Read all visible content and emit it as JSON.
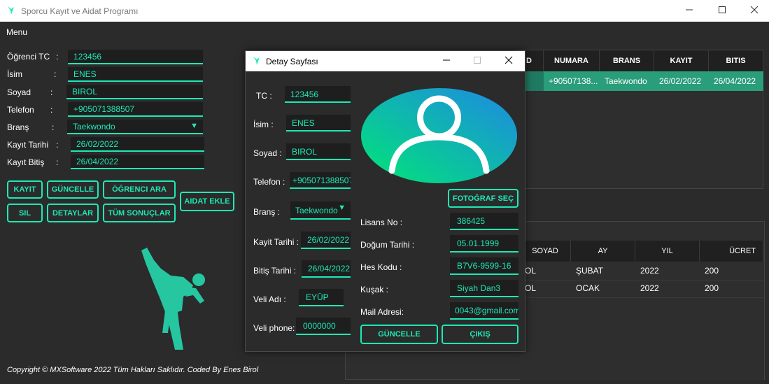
{
  "window": {
    "title": "Sporcu Kayıt ve Aidat Programı"
  },
  "menu": {
    "label": "Menu"
  },
  "form": {
    "tc_label": "Öğrenci TC",
    "tc_sep": ":",
    "tc_value": "123456",
    "isim_label": "İsim",
    "isim_sep": ":",
    "isim_value": "ENES",
    "soyad_label": "Soyad",
    "soyad_sep": ":",
    "soyad_value": "BIROL",
    "telefon_label": "Telefon",
    "telefon_sep": ":",
    "telefon_value": "+905071388507",
    "brans_label": "Branş",
    "brans_sep": ":",
    "brans_value": "Taekwondo",
    "kayit_label": "Kayıt Tarihi",
    "kayit_sep": ":",
    "kayit_value": "26/02/2022",
    "bitis_label": "Kayıt Bitiş",
    "bitis_sep": ":",
    "bitis_value": "26/04/2022"
  },
  "buttons": {
    "kayit": "KAYIT",
    "guncelle": "GÜNCELLE",
    "ogrenci_ara": "ÖĞRENCI ARA",
    "aidat_ekle": "AIDAT EKLE",
    "sil": "SIL",
    "detaylar": "DETAYLAR",
    "tum_sonuclar": "TÜM SONUÇLAR"
  },
  "footer": {
    "text": "Copyright © MXSoftware 2022 Tüm Hakları Saklıdır. Coded By Enes Birol"
  },
  "students_grid": {
    "headers": [
      "D",
      "NUMARA",
      "BRANS",
      "KAYIT",
      "BITIS"
    ],
    "row": [
      "",
      "+90507138...",
      "Taekwondo",
      "26/02/2022",
      "26/04/2022"
    ]
  },
  "payments_grid": {
    "headers": [
      "SOYAD",
      "AY",
      "YIL",
      "ÜCRET"
    ],
    "rows": [
      [
        "OL",
        "ŞUBAT",
        "2022",
        "200"
      ],
      [
        "OL",
        "OCAK",
        "2022",
        "200"
      ]
    ]
  },
  "dialog": {
    "title": "Detay Sayfası",
    "tc_label": "TC :",
    "tc_value": "123456",
    "isim_label": "İsim :",
    "isim_value": "ENES",
    "soyad_label": "Soyad :",
    "soyad_value": "BIROL",
    "telefon_label": "Telefon :",
    "telefon_value": "+905071388507",
    "brans_label": "Branş :",
    "brans_value": "Taekwondo",
    "kayit_label": "Kayit Tarihi :",
    "kayit_value": "26/02/2022",
    "bitis_label": "Bitiş Tarihi :",
    "bitis_value": "26/04/2022",
    "veli_adi_label": "Veli Adı :",
    "veli_adi_value": "EYÜP",
    "veli_phone_label": "Veli phone:",
    "veli_phone_value": "0000000",
    "foto_button": "FOTOĞRAF SEÇ",
    "lisans_label": "Lisans No :",
    "lisans_value": "386425",
    "dogum_label": "Doğum Tarihi :",
    "dogum_value": "05.01.1999",
    "hes_label": "Hes Kodu :",
    "hes_value": "B7V6-9599-16",
    "kusak_label": "Kuşak :",
    "kusak_value": "Siyah Dan3",
    "mail_label": "Mail Adresi:",
    "mail_value": "0043@gmail.com",
    "guncelle_button": "GÜNCELLE",
    "cikis_button": "ÇIKIŞ"
  },
  "colors": {
    "accent": "#1de9b6",
    "background": "#2b2b2b",
    "field_bg": "#1e1e1e"
  },
  "icons": [
    "app-logo-icon",
    "minimize-icon",
    "maximize-icon",
    "close-icon",
    "user-avatar-icon",
    "taekwondo-silhouette-icon"
  ]
}
